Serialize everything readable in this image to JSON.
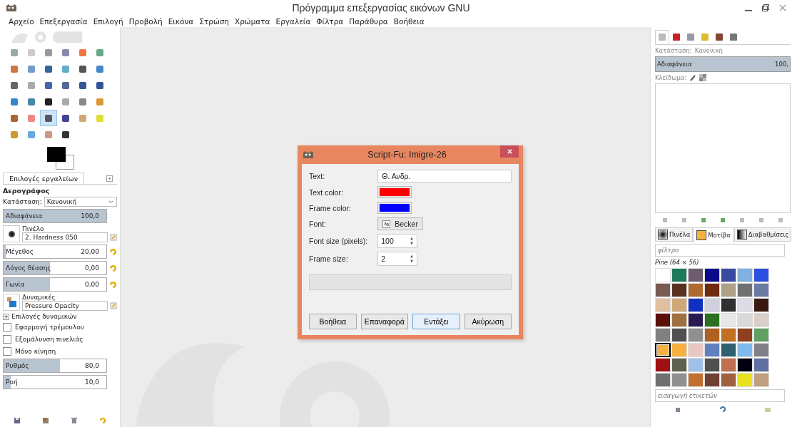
{
  "window": {
    "title": "Πρόγραμμα επεξεργασίας εικόνων GNU"
  },
  "menu": [
    "Αρχείο",
    "Επεξεργασία",
    "Επιλογή",
    "Προβολή",
    "Εικόνα",
    "Στρώση",
    "Χρώματα",
    "Εργαλεία",
    "Φίλτρα",
    "Παράθυρα",
    "Βοήθεια"
  ],
  "tools": [
    {
      "selected": false
    },
    {
      "selected": false
    },
    {
      "selected": false
    },
    {
      "selected": false
    },
    {
      "selected": false
    },
    {
      "selected": false
    },
    {
      "selected": false
    },
    {
      "selected": false
    },
    {
      "selected": false
    },
    {
      "selected": false
    },
    {
      "selected": false
    },
    {
      "selected": false
    },
    {
      "selected": false
    },
    {
      "selected": false
    },
    {
      "selected": false
    },
    {
      "selected": false
    },
    {
      "selected": false
    },
    {
      "selected": false
    },
    {
      "selected": false
    },
    {
      "selected": false
    },
    {
      "selected": false
    },
    {
      "selected": false
    },
    {
      "selected": false
    },
    {
      "selected": false
    },
    {
      "selected": false
    },
    {
      "selected": false
    },
    {
      "selected": true
    },
    {
      "selected": false
    },
    {
      "selected": false
    },
    {
      "selected": false
    },
    {
      "selected": false
    },
    {
      "selected": false
    },
    {
      "selected": false
    },
    {
      "selected": false
    }
  ],
  "tool_options": {
    "tab": "Επιλογές εργαλείων",
    "tool_name": "Αερογράφος",
    "mode_label": "Κατάσταση:",
    "mode_value": "Κανονική",
    "opacity": {
      "label": "Αδιαφάνεια",
      "value": "100,0",
      "level": 1.0
    },
    "brush": {
      "label": "Πινέλο",
      "value": "2. Hardness 050"
    },
    "sliders": [
      {
        "label": "Μέγεθος",
        "value": "20,00",
        "level": 0.02
      },
      {
        "label": "Λόγος θέασης",
        "value": "0,00",
        "level": 0.45
      },
      {
        "label": "Γωνία",
        "value": "0,00",
        "level": 0.45
      }
    ],
    "dynamics": {
      "label": "Δυναμικές",
      "value": "Pressure Opacity"
    },
    "dynamics_options": {
      "label": "Επιλογές δυναμικών",
      "expanded": false
    },
    "checkboxes": [
      {
        "label": "Εφαρμογή τρέμουλου",
        "checked": false
      },
      {
        "label": "Εξομάλυνση πινελιάς",
        "checked": false
      },
      {
        "label": "Μόνο κίνηση",
        "checked": false
      }
    ],
    "rate_sliders": [
      {
        "label": "Ρυθμός",
        "value": "80,0",
        "level": 0.55
      },
      {
        "label": "Ροή",
        "value": "10,0",
        "level": 0.07
      }
    ]
  },
  "dialog": {
    "title": "Script-Fu: Imigre-26",
    "fields": [
      {
        "kind": "text",
        "label": "Text:",
        "value": "Θ. Ανδρ."
      },
      {
        "kind": "color",
        "label": "Text color:",
        "color": "#ff0000"
      },
      {
        "kind": "color",
        "label": "Frame color:",
        "color": "#0000ff"
      },
      {
        "kind": "font",
        "label": "Font:",
        "value": "Becker"
      },
      {
        "kind": "spin",
        "label": "Font size (pixels):",
        "value": "100"
      },
      {
        "kind": "spin",
        "label": "Frame size:",
        "value": "2"
      }
    ],
    "buttons": [
      {
        "label": "Βοήθεια",
        "default": false
      },
      {
        "label": "Επαναφορά",
        "default": false
      },
      {
        "label": "Εντάξει",
        "default": true
      },
      {
        "label": "Ακύρωση",
        "default": false
      }
    ]
  },
  "layers": {
    "tabs": [
      {
        "selected": true
      },
      {
        "selected": false
      },
      {
        "selected": false
      },
      {
        "selected": false
      },
      {
        "selected": false
      },
      {
        "selected": false
      }
    ],
    "mode_label": "Κατάσταση:",
    "mode_value": "Κανονική",
    "opacity": {
      "label": "Αδιαφάνεια",
      "value": "100,",
      "level": 1.0
    },
    "lock_label": "Κλείδωμα:"
  },
  "resources": {
    "tabs": [
      {
        "label": "Πινέλα",
        "selected": false
      },
      {
        "label": "Μοτίβα",
        "selected": true
      },
      {
        "label": "Διαβαθμίσεις",
        "selected": false
      }
    ],
    "filter_placeholder": "φίλτρο",
    "pattern_name": "Pine (64 × 56)",
    "patterns": [
      {
        "color": "#ffffff",
        "selected": false
      },
      {
        "color": "#1d7a5a",
        "selected": false
      },
      {
        "color": "#6e5b6e",
        "selected": false
      },
      {
        "color": "#0a0a8a",
        "selected": false
      },
      {
        "color": "#3a4aa0",
        "selected": false
      },
      {
        "color": "#7fb0e0",
        "selected": false
      },
      {
        "color": "#2a50e0",
        "selected": false
      },
      {
        "color": "#7a5a50",
        "selected": false
      },
      {
        "color": "#5a3020",
        "selected": false
      },
      {
        "color": "#b06a30",
        "selected": false
      },
      {
        "color": "#702a10",
        "selected": false
      },
      {
        "color": "#b0a088",
        "selected": false
      },
      {
        "color": "#707070",
        "selected": false
      },
      {
        "color": "#6a7aa0",
        "selected": false
      },
      {
        "color": "#e0c0a0",
        "selected": false
      },
      {
        "color": "#d0a878",
        "selected": false
      },
      {
        "color": "#1030c0",
        "selected": false
      },
      {
        "color": "#d0d0e0",
        "selected": false
      },
      {
        "color": "#303030",
        "selected": false
      },
      {
        "color": "#dcdce8",
        "selected": false
      },
      {
        "color": "#3a1a10",
        "selected": false
      },
      {
        "color": "#5a1008",
        "selected": false
      },
      {
        "color": "#a07040",
        "selected": false
      },
      {
        "color": "#2a1a50",
        "selected": false
      },
      {
        "color": "#2a7020",
        "selected": false
      },
      {
        "color": "#e8e8e8",
        "selected": false
      },
      {
        "color": "#d8d8d8",
        "selected": false
      },
      {
        "color": "#d8d0c8",
        "selected": false
      },
      {
        "color": "#808080",
        "selected": false
      },
      {
        "color": "#505050",
        "selected": false
      },
      {
        "color": "#909090",
        "selected": false
      },
      {
        "color": "#b06020",
        "selected": false
      },
      {
        "color": "#c07020",
        "selected": false
      },
      {
        "color": "#904020",
        "selected": false
      },
      {
        "color": "#60a060",
        "selected": false
      },
      {
        "color": "#f8b040",
        "selected": true
      },
      {
        "color": "#f8b040",
        "selected": false
      },
      {
        "color": "#e8c8c0",
        "selected": false
      },
      {
        "color": "#6080c0",
        "selected": false
      },
      {
        "color": "#306070",
        "selected": false
      },
      {
        "color": "#80b8f0",
        "selected": false
      },
      {
        "color": "#808088",
        "selected": false
      },
      {
        "color": "#a01010",
        "selected": false
      },
      {
        "color": "#606050",
        "selected": false
      },
      {
        "color": "#a0c0e8",
        "selected": false
      },
      {
        "color": "#505050",
        "selected": false
      },
      {
        "color": "#c07050",
        "selected": false
      },
      {
        "color": "#000010",
        "selected": false
      },
      {
        "color": "#6070a0",
        "selected": false
      },
      {
        "color": "#707070",
        "selected": false
      },
      {
        "color": "#909090",
        "selected": false
      },
      {
        "color": "#c07030",
        "selected": false
      },
      {
        "color": "#704030",
        "selected": false
      },
      {
        "color": "#a06040",
        "selected": false
      },
      {
        "color": "#e8e020",
        "selected": false
      },
      {
        "color": "#c0a080",
        "selected": false
      }
    ],
    "tags_placeholder": "εισαγωγή ετικετών"
  }
}
